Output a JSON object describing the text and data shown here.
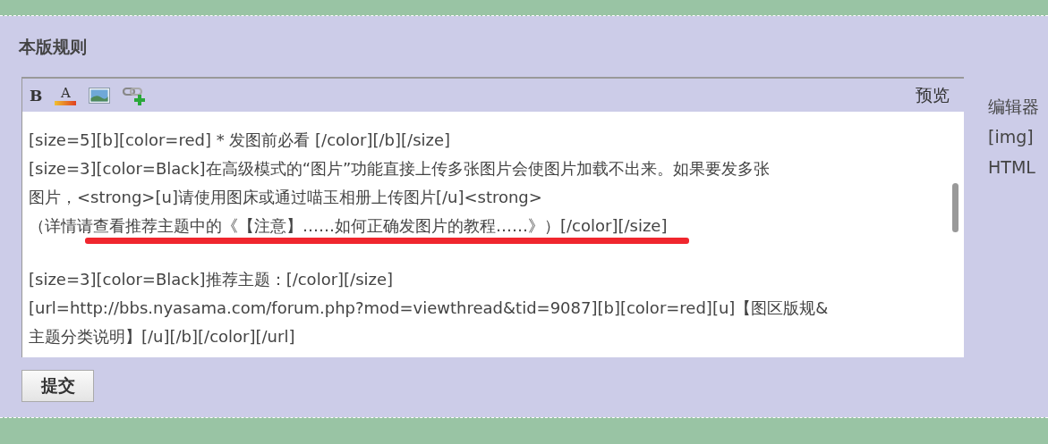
{
  "heading": "本版规则",
  "editor": {
    "toolbar": [
      {
        "kind": "bold",
        "label": "B"
      },
      {
        "kind": "color",
        "label": "A"
      },
      {
        "kind": "image"
      },
      {
        "kind": "link"
      }
    ],
    "preview": "预览",
    "paragraphs": [
      {
        "lines": [
          "[size=5][b][color=red] * 发图前必看 [/color][/b][/size]",
          "[size=3][color=Black]在高级模式的“图片”功能直接上传多张图片会使图片加载不出来。如果要发多张",
          "图片，<strong>[u]请使用图床或通过喵玉相册上传图片[/u]<strong>",
          "（详情请查看推荐主题中的《【注意】……如何正确发图片的教程……》）[/color][/size]"
        ]
      },
      {
        "lines": [
          "[size=3][color=Black]推荐主题：[/color][/size]",
          "[url=http://bbs.nyasama.com/forum.php?mod=viewthread&tid=9087][b][color=red][u]【图区版规&",
          "主题分类说明】[/u][/b][/color][/url]"
        ]
      }
    ],
    "annotations": [
      {
        "kind": "stroke"
      }
    ]
  },
  "submit": "提交",
  "side_notes": [
    "编辑器",
    "[img]",
    "HTML"
  ]
}
